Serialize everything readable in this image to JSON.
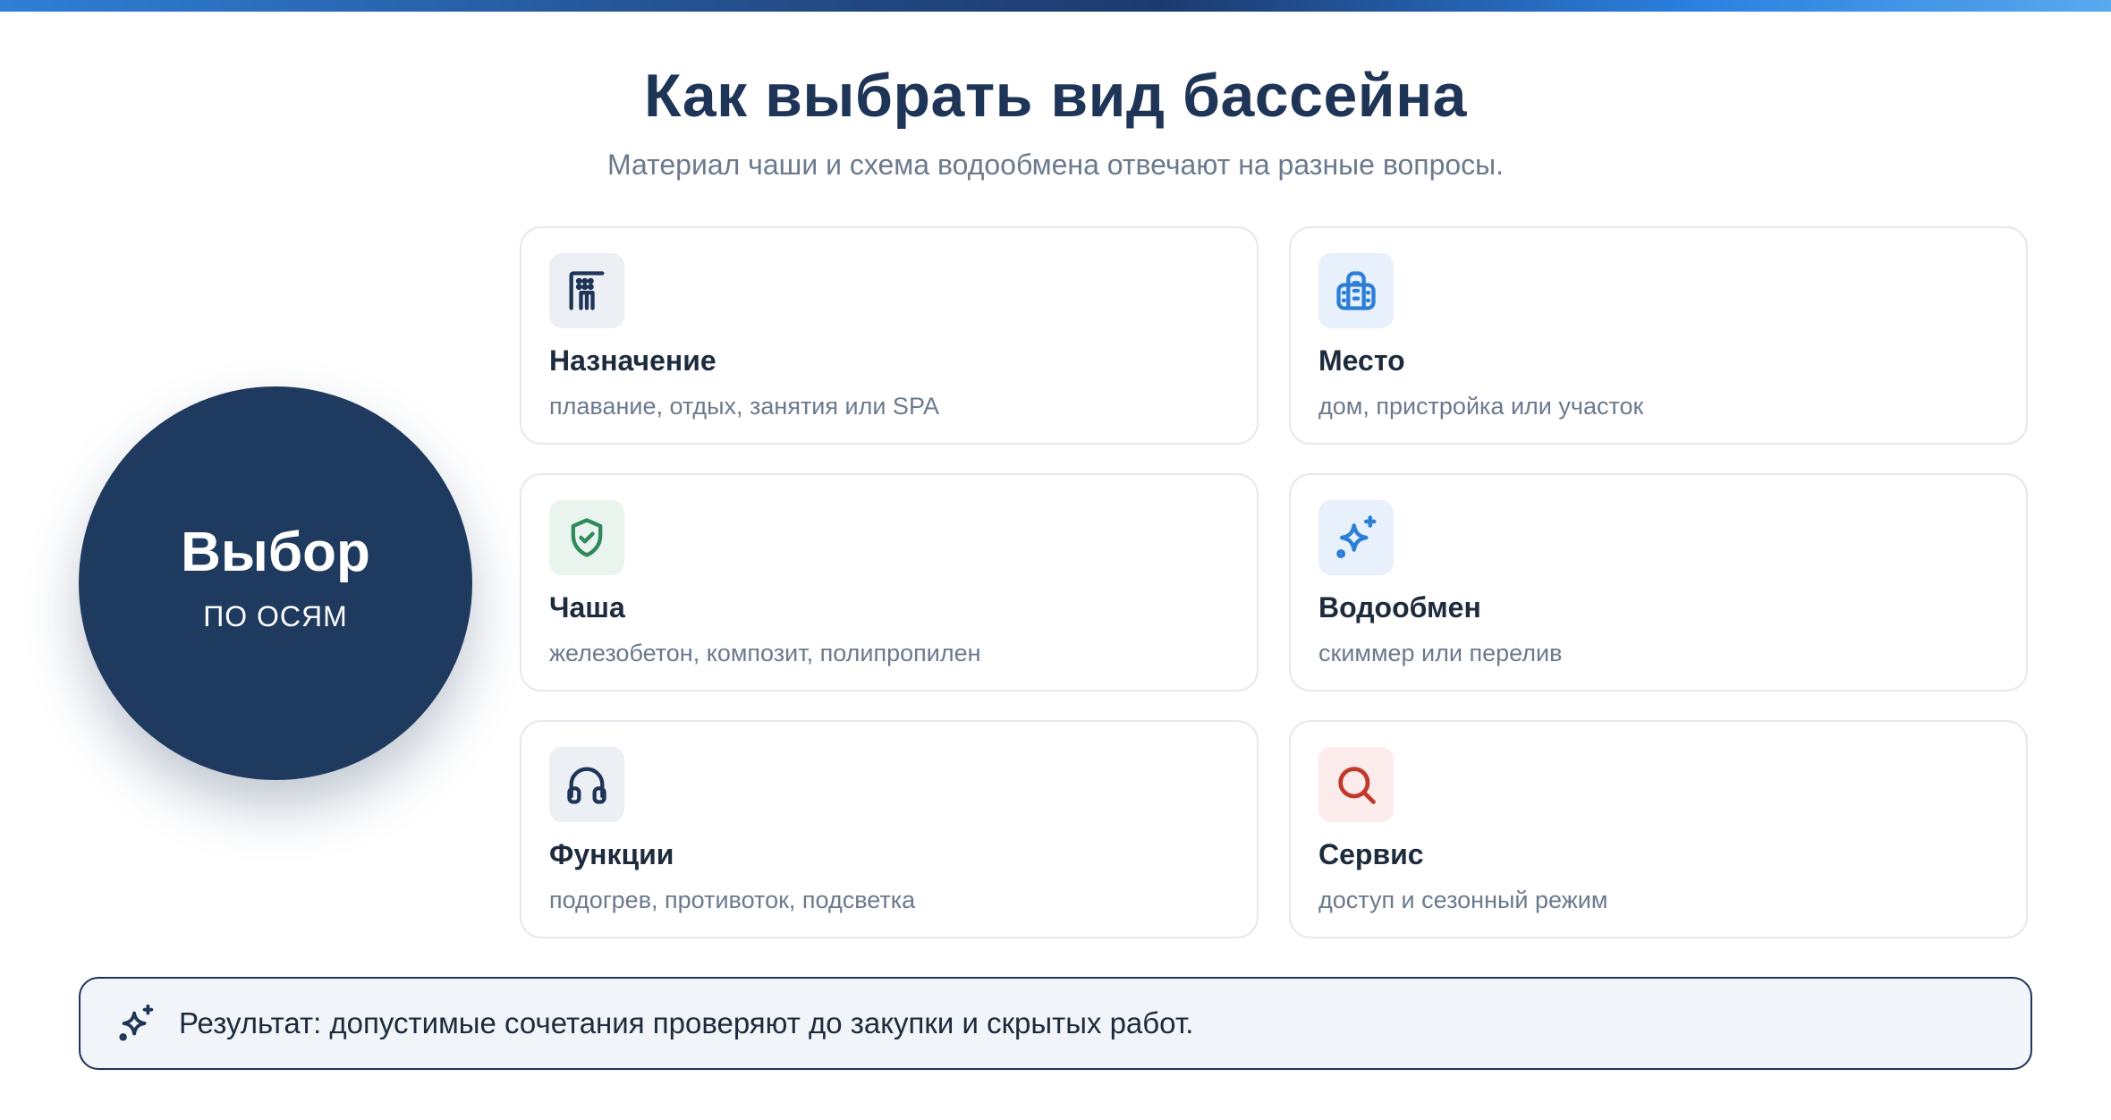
{
  "header": {
    "title": "Как выбрать вид бассейна",
    "subtitle": "Материал чаши и схема водообмена отвечают на разные вопросы."
  },
  "hub": {
    "title": "Выбор",
    "subtitle": "ПО ОСЯМ"
  },
  "cards": [
    {
      "title": "Назначение",
      "desc": "плавание, отдых, занятия или SPA",
      "icon": "pool-ladder-icon",
      "color": "#1f3557",
      "bg": "#eceff3"
    },
    {
      "title": "Место",
      "desc": "дом, пристройка или участок",
      "icon": "building-icon",
      "color": "#2b7fd6",
      "bg": "#e8f1fb"
    },
    {
      "title": "Чаша",
      "desc": "железобетон, композит, полипропилен",
      "icon": "shield-check-icon",
      "color": "#2f8a5b",
      "bg": "#eaf4ee"
    },
    {
      "title": "Водообмен",
      "desc": "скиммер или перелив",
      "icon": "sparkles-icon",
      "color": "#2b7fd6",
      "bg": "#e8f1fb"
    },
    {
      "title": "Функции",
      "desc": "подогрев, противоток, подсветка",
      "icon": "headphones-icon",
      "color": "#1f3557",
      "bg": "#eceff3"
    },
    {
      "title": "Сервис",
      "desc": "доступ и сезонный режим",
      "icon": "search-icon",
      "color": "#c0392b",
      "bg": "#fbeceb"
    }
  ],
  "result": {
    "text": "Результат: допустимые сочетания проверяют до закупки и скрытых работ.",
    "icon": "sparkles-icon"
  }
}
